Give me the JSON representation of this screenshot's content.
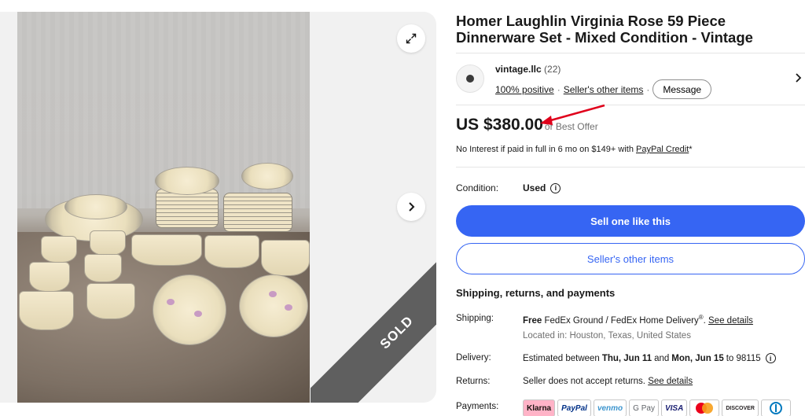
{
  "gallery": {
    "sold_label": "SOLD"
  },
  "listing": {
    "title": "Homer Laughlin Virginia Rose 59 Piece Dinnerware Set - Mixed Condition - Vintage"
  },
  "seller": {
    "name": "vintage.llc",
    "score": "(22)",
    "positive": "100% positive",
    "other_items_link": "Seller's other items",
    "message_button": "Message"
  },
  "price": {
    "amount": "US $380.00",
    "best_offer": "or Best Offer",
    "credit_text": "No Interest if paid in full in 6 mo on $149+ with",
    "credit_link": "PayPal Credit",
    "credit_suffix": "*"
  },
  "condition": {
    "label": "Condition:",
    "value": "Used"
  },
  "actions": {
    "primary": "Sell one like this",
    "secondary": "Seller's other items"
  },
  "shipping": {
    "heading": "Shipping, returns, and payments",
    "shipping_label": "Shipping:",
    "shipping_free": "Free",
    "shipping_value": "FedEx Ground / FedEx Home Delivery",
    "shipping_reg": "®",
    "shipping_link": "See details",
    "location": "Located in: Houston, Texas, United States",
    "delivery_label": "Delivery:",
    "delivery_pre": "Estimated between",
    "delivery_start": "Thu, Jun 11",
    "delivery_and": "and",
    "delivery_end": "Mon, Jun 15",
    "delivery_post": "to 98115",
    "returns_label": "Returns:",
    "returns_value": "Seller does not accept returns.",
    "returns_link": "See details",
    "payments_label": "Payments:",
    "payment_methods": [
      "Klarna",
      "PayPal",
      "venmo",
      "G Pay",
      "VISA",
      "",
      "DISCOVER",
      ""
    ]
  },
  "colors": {
    "primary_blue": "#3665f3",
    "annotation_red": "#e0001b"
  }
}
